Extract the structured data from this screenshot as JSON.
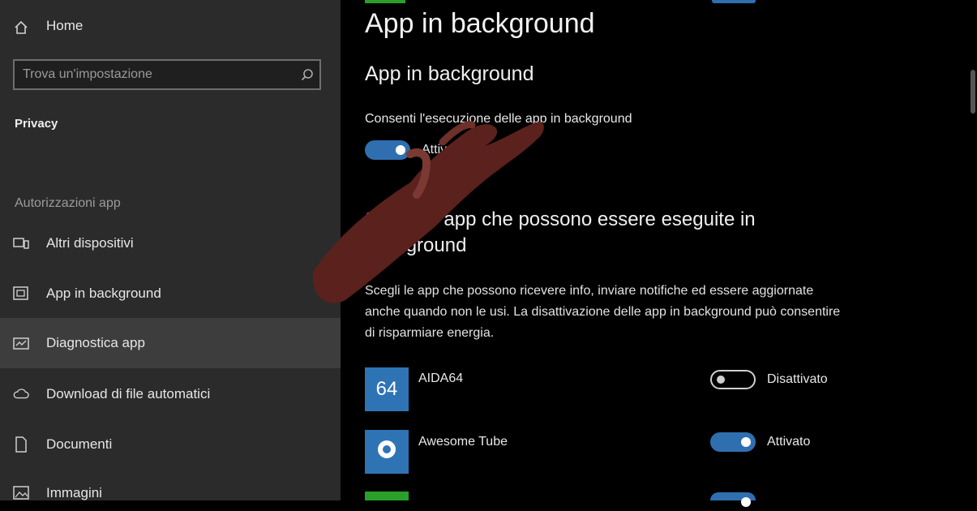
{
  "sidebar": {
    "home_label": "Home",
    "search_placeholder": "Trova un'impostazione",
    "privacy_label": "Privacy",
    "section_header": "Autorizzazioni app",
    "items": [
      {
        "label": "Altri dispositivi",
        "icon": "devices-icon"
      },
      {
        "label": "App in background",
        "icon": "background-apps-icon"
      },
      {
        "label": "Diagnostica app",
        "icon": "diagnostics-icon"
      },
      {
        "label": "Download di file automatici",
        "icon": "cloud-icon"
      },
      {
        "label": "Documenti",
        "icon": "document-icon"
      },
      {
        "label": "Immagini",
        "icon": "image-icon"
      }
    ]
  },
  "main": {
    "page_title": "App in background",
    "sub_title": "App in background",
    "allow_label": "Consenti l'esecuzione delle app in background",
    "allow_state": "Attivato",
    "choose_heading": "Scegli le app che possono essere eseguite in background",
    "description": "Scegli le app che possono ricevere info, inviare notifiche ed essere aggiornate anche quando non le usi. La disattivazione delle app in background può consentire di risparmiare energia.",
    "apps": [
      {
        "name": "AIDA64",
        "tile_text": "64",
        "tile_color": "#2e74b5",
        "state": "Disattivato",
        "on": false
      },
      {
        "name": "Awesome Tube",
        "tile_text": "",
        "tile_color": "#2e74b5",
        "state": "Attivato",
        "on": true
      },
      {
        "name": "",
        "tile_text": "",
        "tile_color": "#2aa02a",
        "state": "",
        "on": true
      }
    ]
  },
  "colors": {
    "accent": "#2f6fb0",
    "sidebar_bg": "#2b2b2b",
    "main_bg": "#000000"
  }
}
